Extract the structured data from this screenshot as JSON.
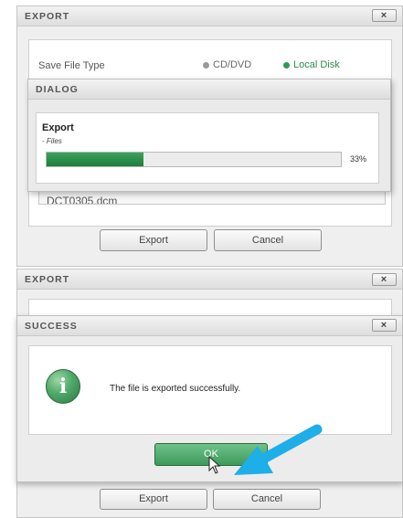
{
  "export_top": {
    "title": "EXPORT",
    "close": "×",
    "save_file_type_label": "Save File Type",
    "options": [
      {
        "label": "CD/DVD",
        "color": "#9a9a9a"
      },
      {
        "label": "Local Disk",
        "color": "#2e9a4f"
      }
    ],
    "file_field_value": "DCT0305.dcm",
    "export_button": "Export",
    "cancel_button": "Cancel"
  },
  "dialog": {
    "title": "DIALOG",
    "heading": "Export",
    "subtext": "- Files",
    "progress_percent": 33,
    "progress_label": "33%",
    "accent": "#1f7d3d"
  },
  "export_bottom": {
    "title": "EXPORT",
    "close": "×",
    "export_button": "Export",
    "cancel_button": "Cancel"
  },
  "success": {
    "title": "SUCCESS",
    "close": "×",
    "icon_glyph": "i",
    "message": "The file is exported successfully.",
    "ok_button": "OK"
  },
  "annotation": {
    "arrow_color": "#1eaee8"
  }
}
